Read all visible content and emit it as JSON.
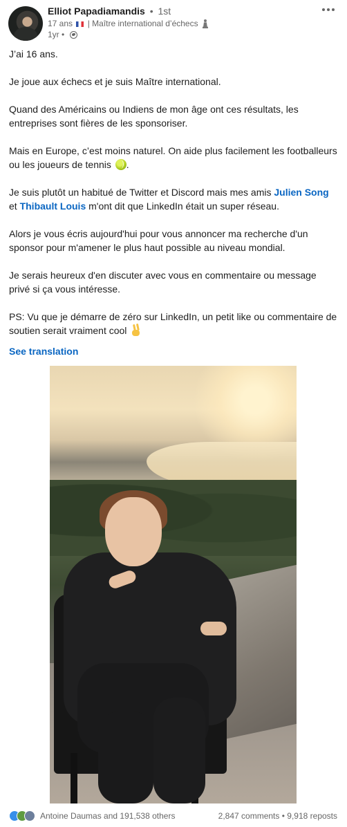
{
  "author": {
    "name": "Elliot Papadiamandis",
    "degree": "1st",
    "subtitle_age": "17 ans",
    "subtitle_title": "| Maître international d’échecs",
    "time": "1yr",
    "separator": "•"
  },
  "post": {
    "paragraphs": {
      "p1": "J’ai 16 ans.",
      "p2": "Je joue aux échecs et je suis Maître international.",
      "p3": "Quand des Américains ou Indiens de mon âge ont ces résultats, les entreprises sont fières de les sponsoriser.",
      "p4_text": "Mais en Europe, c’est moins naturel. On aide plus facilement les footballeurs ou les joueurs de tennis ",
      "p4_end": ".",
      "p5_start": "Je suis plutôt un habitué de Twitter et Discord mais mes amis ",
      "p5_mention1": "Julien Song",
      "p5_mid": " et ",
      "p5_mention2": "Thibault Louis",
      "p5_end": " m'ont dit que LinkedIn était un super réseau.",
      "p6": "Alors je vous écris aujourd'hui pour vous annoncer ma recherche d'un sponsor pour m'amener le plus haut possible au niveau mondial.",
      "p7": "Je serais heureux d'en discuter avec vous en commentaire ou message privé si ça vous intéresse.",
      "p8": "PS: Vu que je démarre de zéro sur LinkedIn, un petit like ou commentaire de soutien serait vraiment cool "
    },
    "see_translation": "See translation"
  },
  "footer": {
    "reactors": "Antoine Daumas and 191,538 others",
    "comments": "2,847 comments",
    "separator": "•",
    "reposts": "9,918 reposts"
  },
  "icons": {
    "more": "more-horizontal-icon",
    "visibility": "globe-icon",
    "flag": "france-flag-icon",
    "chess": "chess-pawn-icon",
    "emoji1": "tennis-ball-emoji",
    "emoji2": "victory-hand-emoji"
  },
  "colors": {
    "link": "#0a66c2",
    "text": "#1d1d1d",
    "muted": "#666666"
  }
}
